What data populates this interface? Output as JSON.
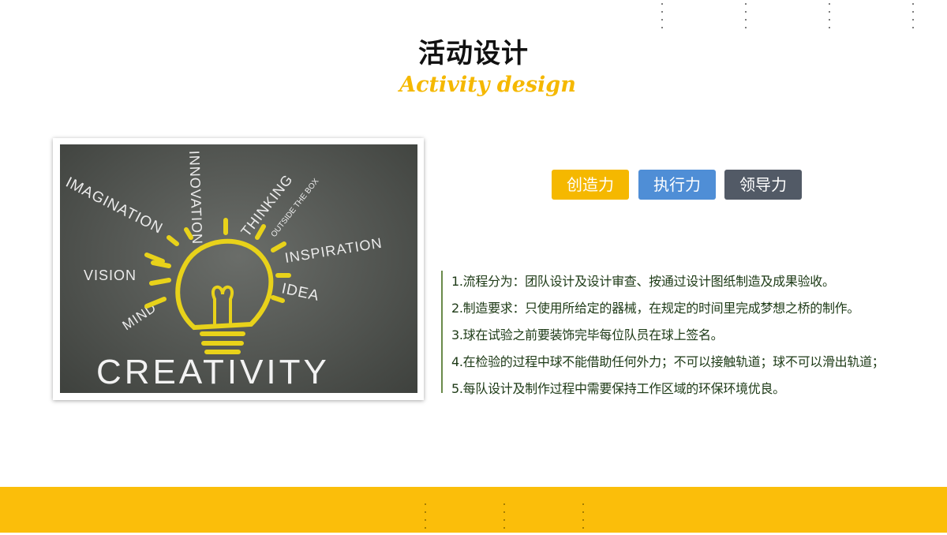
{
  "header": {
    "title": "活动设计",
    "subtitle": "Activity design"
  },
  "image": {
    "words": [
      "IMAGINATION",
      "INNOVATION",
      "THINKING",
      "OUTSIDE THE BOX",
      "INSPIRATION",
      "VISION",
      "IDEA",
      "MIND",
      "CREATIVITY"
    ]
  },
  "tags": [
    {
      "label": "创造力",
      "color": "#f5b800"
    },
    {
      "label": "执行力",
      "color": "#4f8ed6"
    },
    {
      "label": "领导力",
      "color": "#525a66"
    }
  ],
  "points": [
    "1.流程分为：团队设计及设计审查、按通过设计图纸制造及成果验收。",
    "2.制造要求：只使用所给定的器械，在规定的时间里完成梦想之桥的制作。",
    "3.球在试验之前要装饰完毕每位队员在球上签名。",
    "4.在检验的过程中球不能借助任何外力；不可以接触轨道；球不可以滑出轨道；",
    "5.每队设计及制作过程中需要保持工作区域的环保环境优良。"
  ],
  "colors": {
    "accent": "#fbbe0a",
    "text_green": "#1d3a16"
  }
}
